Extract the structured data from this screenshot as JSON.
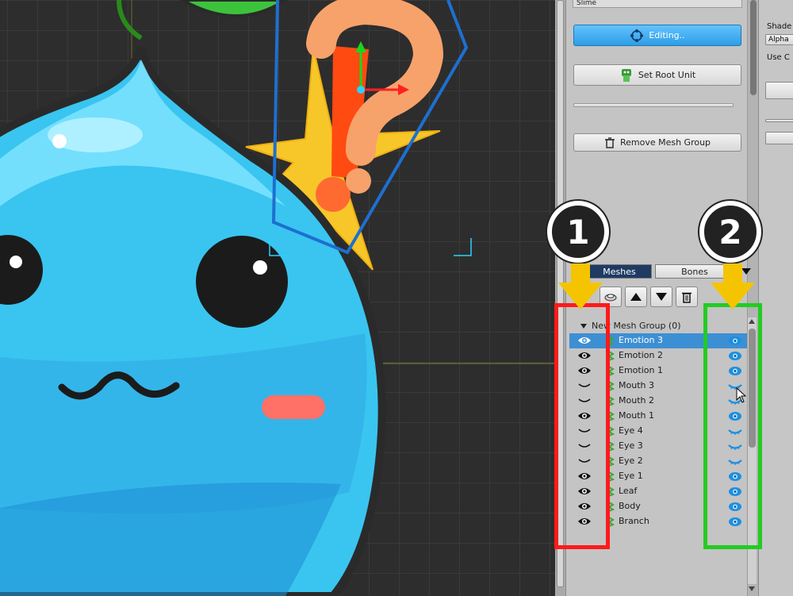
{
  "name_field": "Slime",
  "buttons": {
    "editing": "Editing..",
    "set_root_unit": "Set Root Unit",
    "remove_mesh_group": "Remove Mesh Group"
  },
  "tabs": {
    "meshes": "Meshes",
    "bones": "Bones"
  },
  "group": {
    "label": "New Mesh Group (0)"
  },
  "layers": [
    {
      "name": "Emotion 3",
      "visible": true
    },
    {
      "name": "Emotion 2",
      "visible": true
    },
    {
      "name": "Emotion 1",
      "visible": true
    },
    {
      "name": "Mouth 3",
      "visible": false
    },
    {
      "name": "Mouth 2",
      "visible": false
    },
    {
      "name": "Mouth 1",
      "visible": true
    },
    {
      "name": "Eye 4",
      "visible": false
    },
    {
      "name": "Eye 3",
      "visible": false
    },
    {
      "name": "Eye 2",
      "visible": false
    },
    {
      "name": "Eye 1",
      "visible": true
    },
    {
      "name": "Leaf",
      "visible": true
    },
    {
      "name": "Body",
      "visible": true
    },
    {
      "name": "Branch",
      "visible": true
    }
  ],
  "far_right": {
    "shader_label": "Shade",
    "shader_value": "Alpha",
    "use_label": "Use C"
  },
  "annotations": {
    "badge_1": "1",
    "badge_2": "2"
  },
  "colors": {
    "accent_blue": "#2e9ee6",
    "selected_row": "#3d8fd4",
    "annotation_red": "#ff1a1a",
    "annotation_green": "#22cc22",
    "annotation_arrow": "#f5c400"
  }
}
